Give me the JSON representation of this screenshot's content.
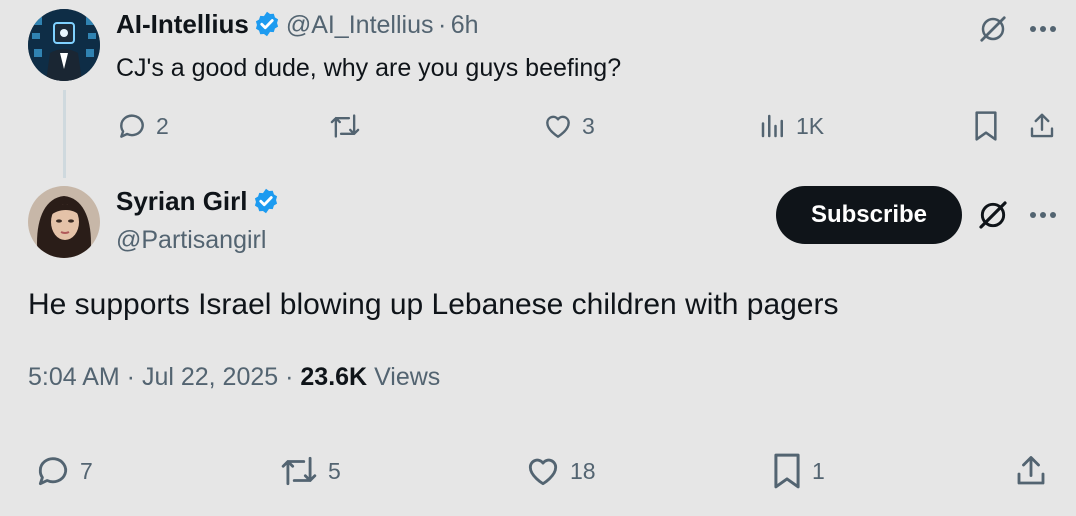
{
  "reply": {
    "display_name": "AI-Intellius",
    "handle": "@AI_Intellius",
    "separator": "·",
    "time": "6h",
    "text": "CJ's a good dude, why are you guys beefing?",
    "actions": {
      "replies": "2",
      "likes": "3",
      "views": "1K"
    }
  },
  "main": {
    "display_name": "Syrian Girl",
    "handle": "@Partisangirl",
    "subscribe_label": "Subscribe",
    "text": "He supports Israel blowing up Lebanese children with pagers",
    "timestamp": "5:04 AM · Jul 22, 2025 ·",
    "views_count": "23.6K",
    "views_label": "Views",
    "actions": {
      "replies": "7",
      "reposts": "5",
      "likes": "18",
      "bookmarks": "1"
    }
  },
  "colors": {
    "verified": "#1d9bf0",
    "muted": "#536471",
    "subscribe_bg": "#0f1419"
  }
}
